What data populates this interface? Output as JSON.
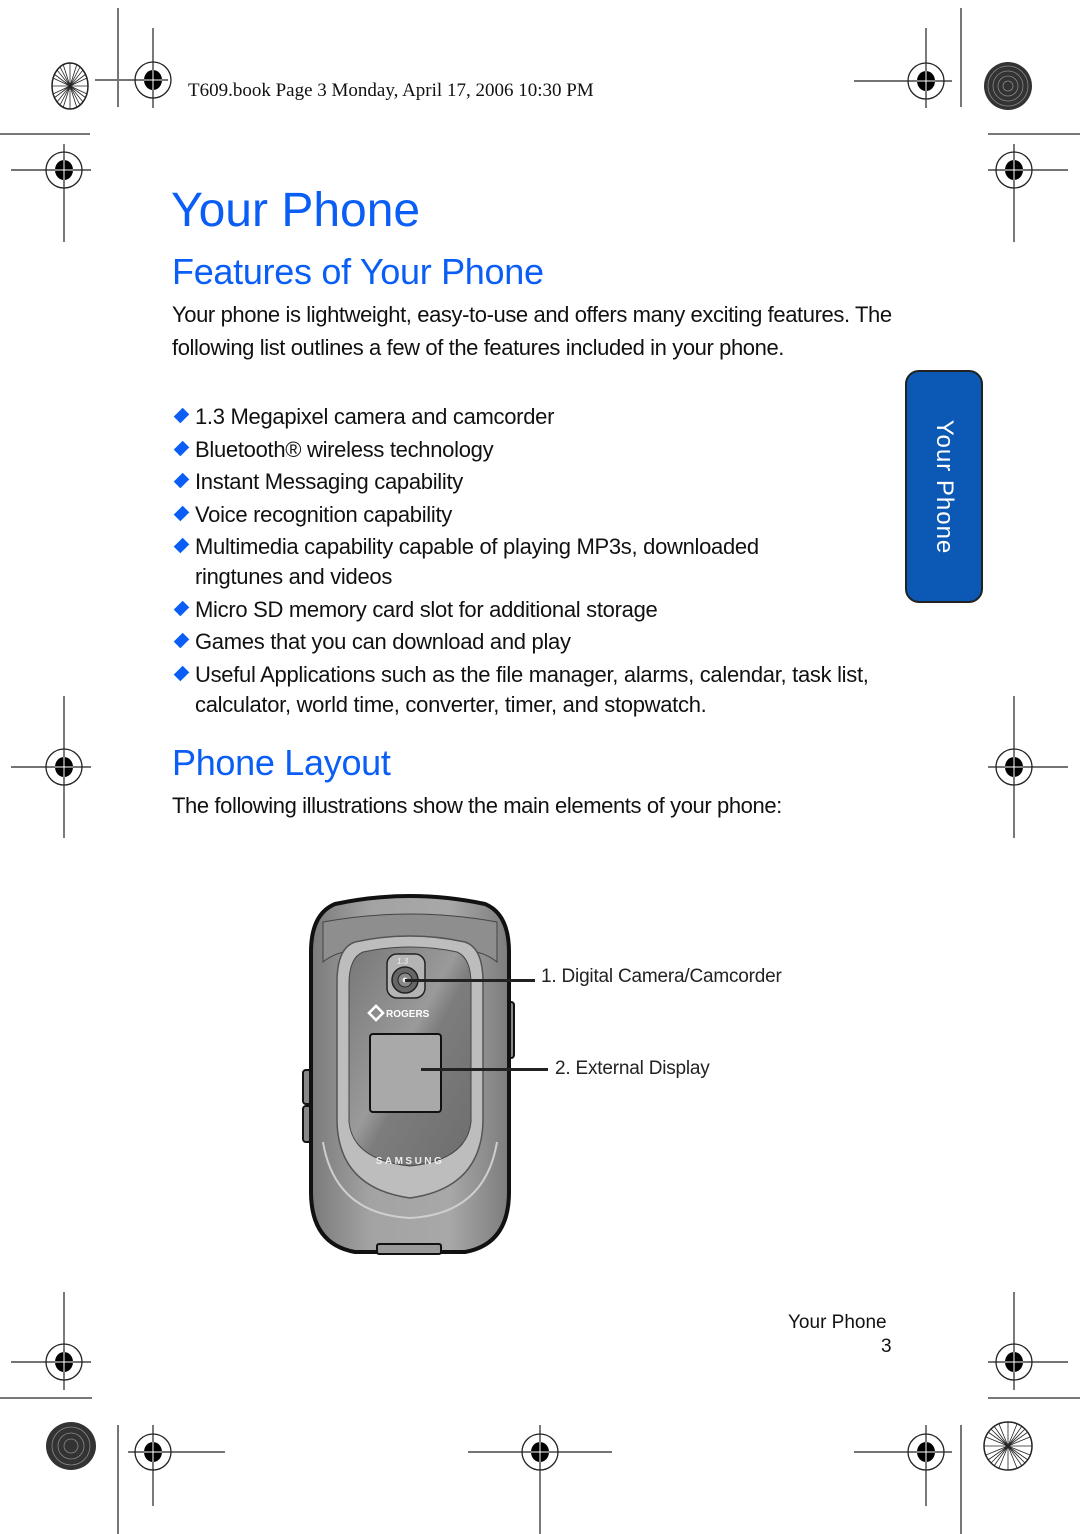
{
  "print_header": "T609.book  Page 3  Monday, April 17, 2006  10:30 PM",
  "chapter_title": "Your Phone",
  "section_tab": "Your Phone",
  "features": {
    "heading": "Features of Your Phone",
    "intro": "Your phone is lightweight, easy-to-use and offers many exciting features. The following list outlines a few of the features included in your phone.",
    "bullets": [
      "1.3 Megapixel camera and camcorder",
      "Bluetooth® wireless technology",
      "Instant Messaging capability",
      "Voice recognition capability",
      "Multimedia capability capable of playing MP3s, downloaded ringtunes and videos",
      "Micro SD memory card slot for additional storage",
      "Games that you can download and play",
      "Useful Applications such as the file manager, alarms, calendar, task list, calculator, world time, converter, timer, and stopwatch."
    ]
  },
  "layout": {
    "heading": "Phone Layout",
    "intro": "The following illustrations show the main elements of your phone:",
    "phone_brand": "SAMSUNG",
    "carrier_brand": "ROGERS",
    "camera_badge": "1.3",
    "callouts": [
      "1. Digital Camera/Camcorder",
      "2. External Display"
    ]
  },
  "footer": {
    "section": "Your Phone",
    "page_number": "3"
  },
  "colors": {
    "heading_blue": "#0a5ef5",
    "tab_blue": "#0b58b5"
  }
}
